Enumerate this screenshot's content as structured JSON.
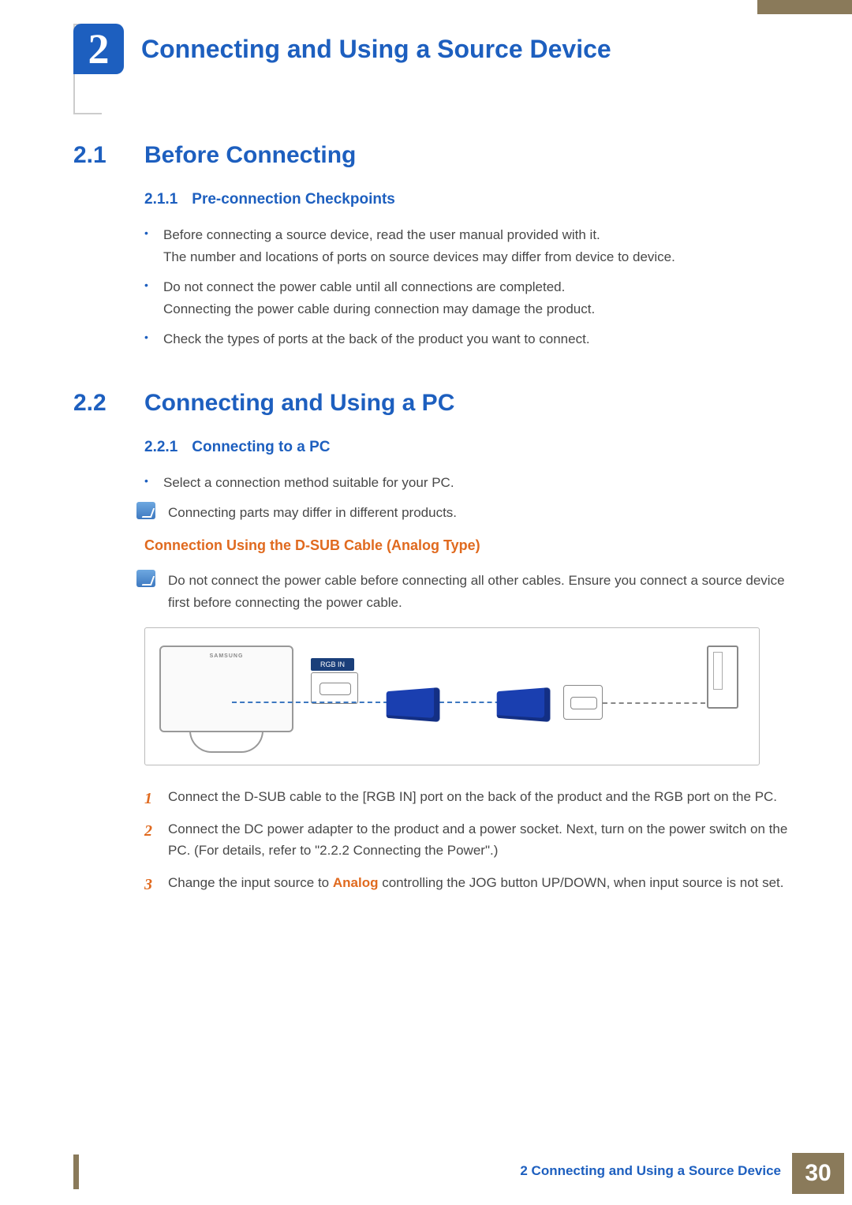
{
  "chapter": {
    "number": "2",
    "title": "Connecting and Using a Source Device"
  },
  "section1": {
    "num": "2.1",
    "title": "Before Connecting",
    "sub": {
      "num": "2.1.1",
      "title": "Pre-connection Checkpoints"
    },
    "bullets": [
      "Before connecting a source device, read the user manual provided with it.\nThe number and locations of ports on source devices may differ from device to device.",
      "Do not connect the power cable until all connections are completed.\nConnecting the power cable during connection may damage the product.",
      "Check the types of ports at the back of the product you want to connect."
    ]
  },
  "section2": {
    "num": "2.2",
    "title": "Connecting and Using a PC",
    "sub": {
      "num": "2.2.1",
      "title": "Connecting to a PC"
    },
    "bullet": "Select a connection method suitable for your PC.",
    "note1": "Connecting parts may differ in different products.",
    "h4": "Connection Using the D-SUB Cable (Analog Type)",
    "note2": "Do not connect the power cable before connecting all other cables. Ensure you connect a source device first before connecting the power cable.",
    "diagram": {
      "brand": "SAMSUNG",
      "port_label": "RGB IN"
    },
    "steps": {
      "s1": "Connect the D-SUB cable to the [RGB IN] port on the back of the product and the RGB port on the PC.",
      "s2": "Connect the DC power adapter to the product and a power socket. Next, turn on the power switch on the PC. (For details, refer to \"2.2.2    Connecting the Power\".)",
      "s3a": "Change the input source to ",
      "s3kw": "Analog",
      "s3b": " controlling the JOG button UP/DOWN, when input source is not set."
    }
  },
  "footer": {
    "text": "2 Connecting and Using a Source Device",
    "page": "30"
  }
}
